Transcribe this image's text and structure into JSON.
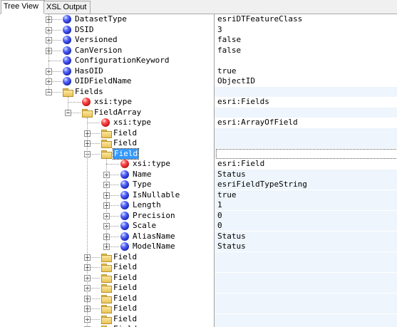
{
  "tabs": {
    "tree_view": "Tree View",
    "xsl_output": "XSL Output"
  },
  "colors": {
    "selection": "#3399ff",
    "value_band": "#eef5fc"
  },
  "rows": [
    {
      "name": "DatasetType",
      "value": "esriDTFeatureClass",
      "icon": "blue-ball-icon",
      "expander": "plus"
    },
    {
      "name": "DSID",
      "value": "3",
      "icon": "blue-ball-icon",
      "expander": "plus"
    },
    {
      "name": "Versioned",
      "value": "false",
      "icon": "blue-ball-icon",
      "expander": "plus"
    },
    {
      "name": "CanVersion",
      "value": "false",
      "icon": "blue-ball-icon",
      "expander": "plus"
    },
    {
      "name": "ConfigurationKeyword",
      "value": "",
      "icon": "blue-ball-icon",
      "expander": "none"
    },
    {
      "name": "HasOID",
      "value": "true",
      "icon": "blue-ball-icon",
      "expander": "plus"
    },
    {
      "name": "OIDFieldName",
      "value": "ObjectID",
      "icon": "blue-ball-icon",
      "expander": "plus"
    },
    {
      "name": "Fields",
      "value": "",
      "icon": "folder-icon",
      "expander": "minus"
    },
    {
      "name": "xsi:type",
      "value": "esri:Fields",
      "icon": "red-ball-icon",
      "expander": "none"
    },
    {
      "name": "FieldArray",
      "value": "",
      "icon": "folder-icon",
      "expander": "minus"
    },
    {
      "name": "xsi:type",
      "value": "esri:ArrayOfField",
      "icon": "red-ball-icon",
      "expander": "none"
    },
    {
      "name": "Field",
      "value": "",
      "icon": "folder-icon",
      "expander": "plus"
    },
    {
      "name": "Field",
      "value": "",
      "icon": "folder-icon",
      "expander": "plus"
    },
    {
      "name": "Field",
      "value": "",
      "icon": "folder-icon",
      "expander": "minus",
      "selected": true
    },
    {
      "name": "xsi:type",
      "value": "esri:Field",
      "icon": "red-ball-icon",
      "expander": "none"
    },
    {
      "name": "Name",
      "value": "Status",
      "icon": "blue-ball-icon",
      "expander": "plus"
    },
    {
      "name": "Type",
      "value": "esriFieldTypeString",
      "icon": "blue-ball-icon",
      "expander": "plus"
    },
    {
      "name": "IsNullable",
      "value": "true",
      "icon": "blue-ball-icon",
      "expander": "plus"
    },
    {
      "name": "Length",
      "value": "1",
      "icon": "blue-ball-icon",
      "expander": "plus"
    },
    {
      "name": "Precision",
      "value": "0",
      "icon": "blue-ball-icon",
      "expander": "plus"
    },
    {
      "name": "Scale",
      "value": "0",
      "icon": "blue-ball-icon",
      "expander": "plus"
    },
    {
      "name": "AliasName",
      "value": "Status",
      "icon": "blue-ball-icon",
      "expander": "plus"
    },
    {
      "name": "ModelName",
      "value": "Status",
      "icon": "blue-ball-icon",
      "expander": "plus"
    },
    {
      "name": "Field",
      "value": "",
      "icon": "folder-icon",
      "expander": "plus"
    },
    {
      "name": "Field",
      "value": "",
      "icon": "folder-icon",
      "expander": "plus"
    },
    {
      "name": "Field",
      "value": "",
      "icon": "folder-icon",
      "expander": "plus"
    },
    {
      "name": "Field",
      "value": "",
      "icon": "folder-icon",
      "expander": "plus"
    },
    {
      "name": "Field",
      "value": "",
      "icon": "folder-icon",
      "expander": "plus"
    },
    {
      "name": "Field",
      "value": "",
      "icon": "folder-icon",
      "expander": "plus"
    },
    {
      "name": "Field",
      "value": "",
      "icon": "folder-icon",
      "expander": "plus"
    },
    {
      "name": "Field",
      "value": "",
      "icon": "folder-icon",
      "expander": "plus"
    }
  ]
}
